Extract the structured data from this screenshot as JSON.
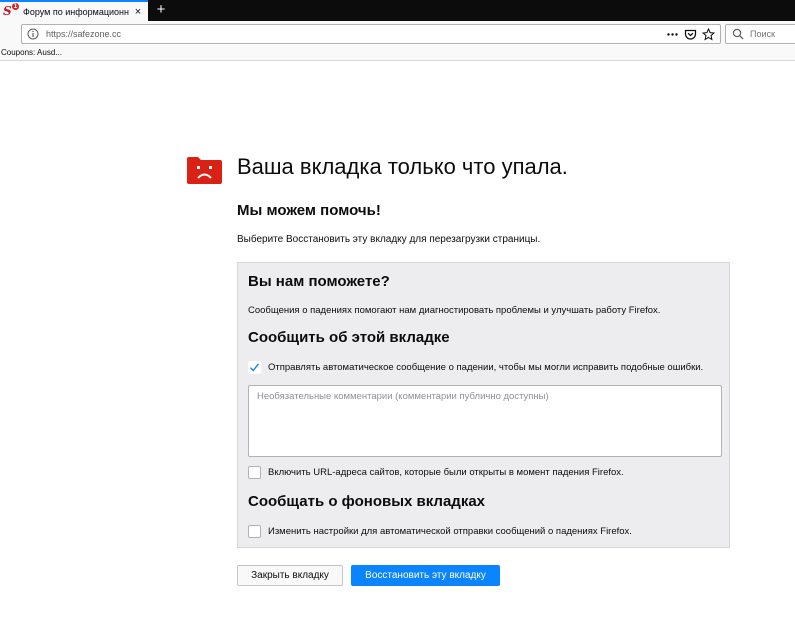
{
  "browser": {
    "tab": {
      "title": "Форум по информационной",
      "favicon_letter": "S",
      "favicon_badge": "1",
      "close_glyph": "×"
    },
    "new_tab_glyph": "+",
    "url": "https://safezone.cc",
    "search_placeholder": "Поиск",
    "bookmarks": [
      {
        "label": "Coupons: Ausd..."
      }
    ],
    "accent_color": "#0a84ff"
  },
  "crash_page": {
    "title": "Ваша вкладка только что упала.",
    "help_title": "Мы можем помочь!",
    "restore_hint": "Выберите Восстановить эту вкладку для перезагрузки страницы.",
    "icon": "sad-tab-icon",
    "icon_color": "#d92215",
    "report": {
      "heading": "Вы нам поможете?",
      "description": "Сообщения о падениях помогают нам диагностировать проблемы и улучшать работу Firefox.",
      "tab_section_heading": "Сообщить об этой вкладке",
      "auto_send_label": "Отправлять автоматическое сообщение о падении, чтобы мы могли исправить подобные ошибки.",
      "auto_send_checked": true,
      "comments_placeholder": "Необязательные комментарии (комментарии публично доступны)",
      "include_urls_label": "Включить URL-адреса сайтов, которые были открыты в момент падения Firefox.",
      "include_urls_checked": false,
      "background_heading": "Сообщать о фоновых вкладках",
      "background_label": "Изменить настройки для автоматической отправки сообщений о падениях Firefox.",
      "background_checked": false
    },
    "buttons": {
      "close_tab": "Закрыть вкладку",
      "restore_tab": "Восстановить эту вкладку"
    }
  }
}
